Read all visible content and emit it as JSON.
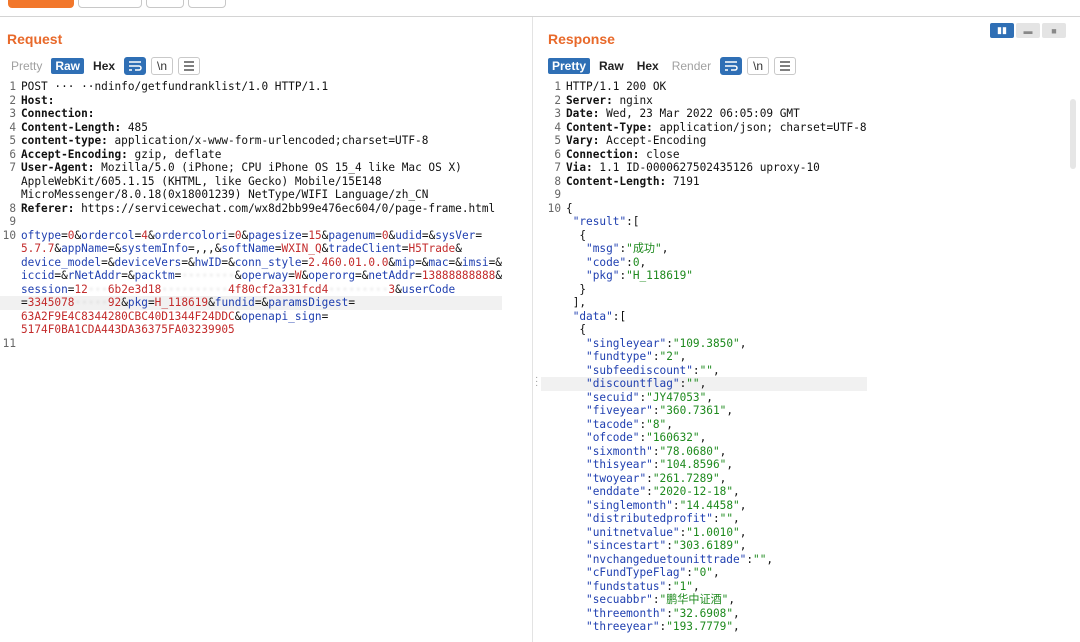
{
  "request": {
    "title": "Request",
    "tabs": {
      "pretty": "Pretty",
      "raw": "Raw",
      "hex": "Hex"
    },
    "wrap_icon": "wrap-icon",
    "newline_label": "\\n",
    "menu_icon": "menu-icon",
    "headers": [
      {
        "n": "1",
        "text": "POST ··· ··ndinfo/getfundranklist/1.0 HTTP/1.1"
      },
      {
        "n": "2",
        "name": "Host:",
        "value": ""
      },
      {
        "n": "3",
        "name": "Connection:",
        "value": ""
      },
      {
        "n": "4",
        "name": "Content-Length:",
        "value": " 485"
      },
      {
        "n": "5",
        "name": "content-type:",
        "value": " application/x-www-form-urlencoded;charset=UTF-8"
      },
      {
        "n": "6",
        "name": "Accept-Encoding:",
        "value": " gzip, deflate"
      },
      {
        "n": "7",
        "name": "User-Agent:",
        "value": " Mozilla/5.0 (iPhone; CPU iPhone OS 15_4 like Mac OS X)"
      },
      {
        "n": "",
        "text": "AppleWebKit/605.1.15 (KHTML, like Gecko) Mobile/15E148"
      },
      {
        "n": "",
        "text": "MicroMessenger/8.0.18(0x18001239) NetType/WIFI Language/zh_CN"
      },
      {
        "n": "8",
        "name": "Referer:",
        "value": " https://servicewechat.com/wx8d2bb99e476ec604/0/page-frame.html"
      },
      {
        "n": "9",
        "text": ""
      }
    ],
    "body_lines": [
      {
        "n": "10",
        "parts": [
          [
            "k",
            "oftype"
          ],
          [
            "p",
            "="
          ],
          [
            "v",
            "0"
          ],
          [
            "p",
            "&"
          ],
          [
            "k",
            "ordercol"
          ],
          [
            "p",
            "="
          ],
          [
            "v",
            "4"
          ],
          [
            "p",
            "&"
          ],
          [
            "k",
            "ordercolori"
          ],
          [
            "p",
            "="
          ],
          [
            "v",
            "0"
          ],
          [
            "p",
            "&"
          ],
          [
            "k",
            "pagesize"
          ],
          [
            "p",
            "="
          ],
          [
            "v",
            "15"
          ],
          [
            "p",
            "&"
          ],
          [
            "k",
            "pagenum"
          ],
          [
            "p",
            "="
          ],
          [
            "v",
            "0"
          ],
          [
            "p",
            "&"
          ],
          [
            "k",
            "udid"
          ],
          [
            "p",
            "=&"
          ],
          [
            "k",
            "sysVer"
          ],
          [
            "p",
            "="
          ]
        ]
      },
      {
        "n": "",
        "parts": [
          [
            "v",
            "5.7.7"
          ],
          [
            "p",
            "&"
          ],
          [
            "k",
            "appName"
          ],
          [
            "p",
            "=&"
          ],
          [
            "k",
            "systemInfo"
          ],
          [
            "p",
            "=,,,&"
          ],
          [
            "k",
            "softName"
          ],
          [
            "p",
            "="
          ],
          [
            "v",
            "WXIN_Q"
          ],
          [
            "p",
            "&"
          ],
          [
            "k",
            "tradeClient"
          ],
          [
            "p",
            "="
          ],
          [
            "v",
            "H5Trade"
          ],
          [
            "p",
            "&"
          ]
        ]
      },
      {
        "n": "",
        "parts": [
          [
            "k",
            "device_model"
          ],
          [
            "p",
            "=&"
          ],
          [
            "k",
            "deviceVers"
          ],
          [
            "p",
            "=&"
          ],
          [
            "k",
            "hwID"
          ],
          [
            "p",
            "=&"
          ],
          [
            "k",
            "conn_style"
          ],
          [
            "p",
            "="
          ],
          [
            "v",
            "2.460.01.0.0"
          ],
          [
            "p",
            "&"
          ],
          [
            "k",
            "mip"
          ],
          [
            "p",
            "=&"
          ],
          [
            "k",
            "mac"
          ],
          [
            "p",
            "=&"
          ],
          [
            "k",
            "imsi"
          ],
          [
            "p",
            "=&"
          ]
        ]
      },
      {
        "n": "",
        "parts": [
          [
            "k",
            "iccid"
          ],
          [
            "p",
            "=&"
          ],
          [
            "k",
            "rNetAddr"
          ],
          [
            "p",
            "=&"
          ],
          [
            "k",
            "packtm"
          ],
          [
            "p",
            "="
          ],
          [
            "x",
            "········"
          ],
          [
            "p",
            "&"
          ],
          [
            "k",
            "operway"
          ],
          [
            "p",
            "="
          ],
          [
            "v",
            "W"
          ],
          [
            "p",
            "&"
          ],
          [
            "k",
            "operorg"
          ],
          [
            "p",
            "=&"
          ],
          [
            "k",
            "netAddr"
          ],
          [
            "p",
            "="
          ],
          [
            "v",
            "13888888888"
          ],
          [
            "p",
            "&"
          ]
        ]
      },
      {
        "n": "",
        "parts": [
          [
            "k",
            "session"
          ],
          [
            "p",
            "="
          ],
          [
            "v",
            "12"
          ],
          [
            "x",
            "···"
          ],
          [
            "v",
            "6b2e3d18"
          ],
          [
            "x",
            "··········"
          ],
          [
            "v",
            "4f80cf2a331fcd4"
          ],
          [
            "x",
            "·········"
          ],
          [
            "v",
            "3"
          ],
          [
            "p",
            "&"
          ],
          [
            "k",
            "userCode"
          ]
        ]
      },
      {
        "n": "",
        "hl": true,
        "parts": [
          [
            "p",
            "="
          ],
          [
            "v",
            "3345078"
          ],
          [
            "x",
            "·····"
          ],
          [
            "v",
            "92"
          ],
          [
            "p",
            "&"
          ],
          [
            "k",
            "pkg"
          ],
          [
            "p",
            "="
          ],
          [
            "v",
            "H_118619"
          ],
          [
            "p",
            "&"
          ],
          [
            "k",
            "fundid"
          ],
          [
            "p",
            "=&"
          ],
          [
            "k",
            "paramsDigest"
          ],
          [
            "p",
            "="
          ]
        ]
      },
      {
        "n": "",
        "parts": [
          [
            "v",
            "63A2F9E4C8344280CBC40D1344F24DDC"
          ],
          [
            "p",
            "&"
          ],
          [
            "k",
            "openapi_sign"
          ],
          [
            "p",
            "="
          ]
        ]
      },
      {
        "n": "",
        "parts": [
          [
            "v",
            "5174F0BA1CDA443DA36375FA03239905"
          ]
        ]
      },
      {
        "n": "11",
        "parts": []
      }
    ]
  },
  "response": {
    "title": "Response",
    "tabs": {
      "pretty": "Pretty",
      "raw": "Raw",
      "hex": "Hex",
      "render": "Render"
    },
    "wrap_icon": "wrap-icon",
    "newline_label": "\\n",
    "menu_icon": "menu-icon",
    "headers": [
      {
        "n": "1",
        "text": "HTTP/1.1 200 OK"
      },
      {
        "n": "2",
        "name": "Server:",
        "value": " nginx"
      },
      {
        "n": "3",
        "name": "Date:",
        "value": " Wed, 23 Mar 2022 06:05:09 GMT"
      },
      {
        "n": "4",
        "name": "Content-Type:",
        "value": " application/json; charset=UTF-8"
      },
      {
        "n": "5",
        "name": "Vary:",
        "value": " Accept-Encoding"
      },
      {
        "n": "6",
        "name": "Connection:",
        "value": " close"
      },
      {
        "n": "7",
        "name": "Via:",
        "value": " 1.1 ID-0000627502435126 uproxy-10"
      },
      {
        "n": "8",
        "name": "Content-Length:",
        "value": " 7191"
      },
      {
        "n": "9",
        "text": ""
      }
    ],
    "json_lines": [
      {
        "n": "10",
        "i": "",
        "p": "{"
      },
      {
        "n": "",
        "i": " ",
        "k": "\"result\"",
        "p": ":["
      },
      {
        "n": "",
        "i": "  ",
        "p": "{"
      },
      {
        "n": "",
        "i": "   ",
        "k": "\"msg\"",
        "p": ":",
        "s": "\"成功\"",
        "t": ","
      },
      {
        "n": "",
        "i": "   ",
        "k": "\"code\"",
        "p": ":",
        "s": "0",
        "t": ","
      },
      {
        "n": "",
        "i": "   ",
        "k": "\"pkg\"",
        "p": ":",
        "s": "\"H_118619\""
      },
      {
        "n": "",
        "i": "  ",
        "p": "}"
      },
      {
        "n": "",
        "i": " ",
        "p": "],"
      },
      {
        "n": "",
        "i": " ",
        "k": "\"data\"",
        "p": ":["
      },
      {
        "n": "",
        "i": "  ",
        "p": "{"
      },
      {
        "n": "",
        "i": "   ",
        "k": "\"singleyear\"",
        "p": ":",
        "s": "\"109.3850\"",
        "t": ","
      },
      {
        "n": "",
        "i": "   ",
        "k": "\"fundtype\"",
        "p": ":",
        "s": "\"2\"",
        "t": ","
      },
      {
        "n": "",
        "i": "   ",
        "k": "\"subfeediscount\"",
        "p": ":",
        "s": "\"\"",
        "t": ","
      },
      {
        "n": "",
        "i": "   ",
        "k": "\"discountflag\"",
        "p": ":",
        "s": "\"\"",
        "t": ",",
        "hl": true
      },
      {
        "n": "",
        "i": "   ",
        "k": "\"secuid\"",
        "p": ":",
        "s": "\"JY47053\"",
        "t": ","
      },
      {
        "n": "",
        "i": "   ",
        "k": "\"fiveyear\"",
        "p": ":",
        "s": "\"360.7361\"",
        "t": ","
      },
      {
        "n": "",
        "i": "   ",
        "k": "\"tacode\"",
        "p": ":",
        "s": "\"8\"",
        "t": ","
      },
      {
        "n": "",
        "i": "   ",
        "k": "\"ofcode\"",
        "p": ":",
        "s": "\"160632\"",
        "t": ","
      },
      {
        "n": "",
        "i": "   ",
        "k": "\"sixmonth\"",
        "p": ":",
        "s": "\"78.0680\"",
        "t": ","
      },
      {
        "n": "",
        "i": "   ",
        "k": "\"thisyear\"",
        "p": ":",
        "s": "\"104.8596\"",
        "t": ","
      },
      {
        "n": "",
        "i": "   ",
        "k": "\"twoyear\"",
        "p": ":",
        "s": "\"261.7289\"",
        "t": ","
      },
      {
        "n": "",
        "i": "   ",
        "k": "\"enddate\"",
        "p": ":",
        "s": "\"2020-12-18\"",
        "t": ","
      },
      {
        "n": "",
        "i": "   ",
        "k": "\"singlemonth\"",
        "p": ":",
        "s": "\"14.4458\"",
        "t": ","
      },
      {
        "n": "",
        "i": "   ",
        "k": "\"distributedprofit\"",
        "p": ":",
        "s": "\"\"",
        "t": ","
      },
      {
        "n": "",
        "i": "   ",
        "k": "\"unitnetvalue\"",
        "p": ":",
        "s": "\"1.0010\"",
        "t": ","
      },
      {
        "n": "",
        "i": "   ",
        "k": "\"sincestart\"",
        "p": ":",
        "s": "\"303.6189\"",
        "t": ","
      },
      {
        "n": "",
        "i": "   ",
        "k": "\"nvchangeduetounittrade\"",
        "p": ":",
        "s": "\"\"",
        "t": ","
      },
      {
        "n": "",
        "i": "   ",
        "k": "\"cFundTypeFlag\"",
        "p": ":",
        "s": "\"0\"",
        "t": ","
      },
      {
        "n": "",
        "i": "   ",
        "k": "\"fundstatus\"",
        "p": ":",
        "s": "\"1\"",
        "t": ","
      },
      {
        "n": "",
        "i": "   ",
        "k": "\"secuabbr\"",
        "p": ":",
        "s": "\"鹏华中证酒\"",
        "t": ","
      },
      {
        "n": "",
        "i": "   ",
        "k": "\"threemonth\"",
        "p": ":",
        "s": "\"32.6908\"",
        "t": ","
      },
      {
        "n": "",
        "i": "   ",
        "k": "\"threeyear\"",
        "p": ":",
        "s": "\"193.7779\"",
        "t": ","
      }
    ]
  },
  "colors": {
    "accent": "#e8692a",
    "selected": "#2f6fb5",
    "param_key": "#1f3fb0",
    "param_value": "#c32b2b",
    "json_string": "#1e8a1e"
  }
}
